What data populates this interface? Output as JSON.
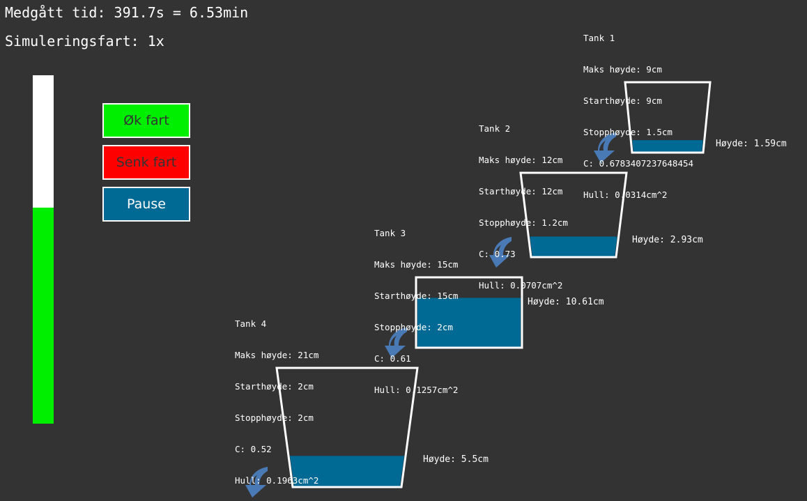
{
  "header": {
    "elapsed": "Medgått tid: 391.7s = 6.53min",
    "speed": "Simuleringsfart: 1x"
  },
  "progress": {
    "fraction_filled": 0.62
  },
  "buttons": {
    "increase": "Øk fart",
    "decrease": "Senk fart",
    "pause": "Pause"
  },
  "colors": {
    "background": "#333333",
    "water": "#006994",
    "arrow": "#4a7ab5",
    "increase_button": "#00ee00",
    "decrease_button": "#ff0000"
  },
  "tanks": [
    {
      "name": "Tank 1",
      "max": "Maks høyde: 9cm",
      "start": "Starthøyde: 9cm",
      "stop": "Stopphøyde: 1.5cm",
      "c": "C: 0.6783407237648454",
      "hole": "Hull: 0.0314cm^2",
      "height": "Høyde: 1.59cm",
      "level": 1.59,
      "max_level": 9
    },
    {
      "name": "Tank 2",
      "max": "Maks høyde: 12cm",
      "start": "Starthøyde: 12cm",
      "stop": "Stopphøyde: 1.2cm",
      "c": "C: 0.73",
      "hole": "Hull: 0.0707cm^2",
      "height": "Høyde: 2.93cm",
      "level": 2.93,
      "max_level": 12
    },
    {
      "name": "Tank 3",
      "max": "Maks høyde: 15cm",
      "start": "Starthøyde: 15cm",
      "stop": "Stopphøyde: 2cm",
      "c": "C: 0.61",
      "hole": "Hull: 0.1257cm^2",
      "height": "Høyde: 10.61cm",
      "level": 10.61,
      "max_level": 15
    },
    {
      "name": "Tank 4",
      "max": "Maks høyde: 21cm",
      "start": "Starthøyde: 2cm",
      "stop": "Stopphøyde: 2cm",
      "c": "C: 0.52",
      "hole": "Hull: 0.1963cm^2",
      "height": "Høyde: 5.5cm",
      "level": 5.5,
      "max_level": 21
    }
  ]
}
